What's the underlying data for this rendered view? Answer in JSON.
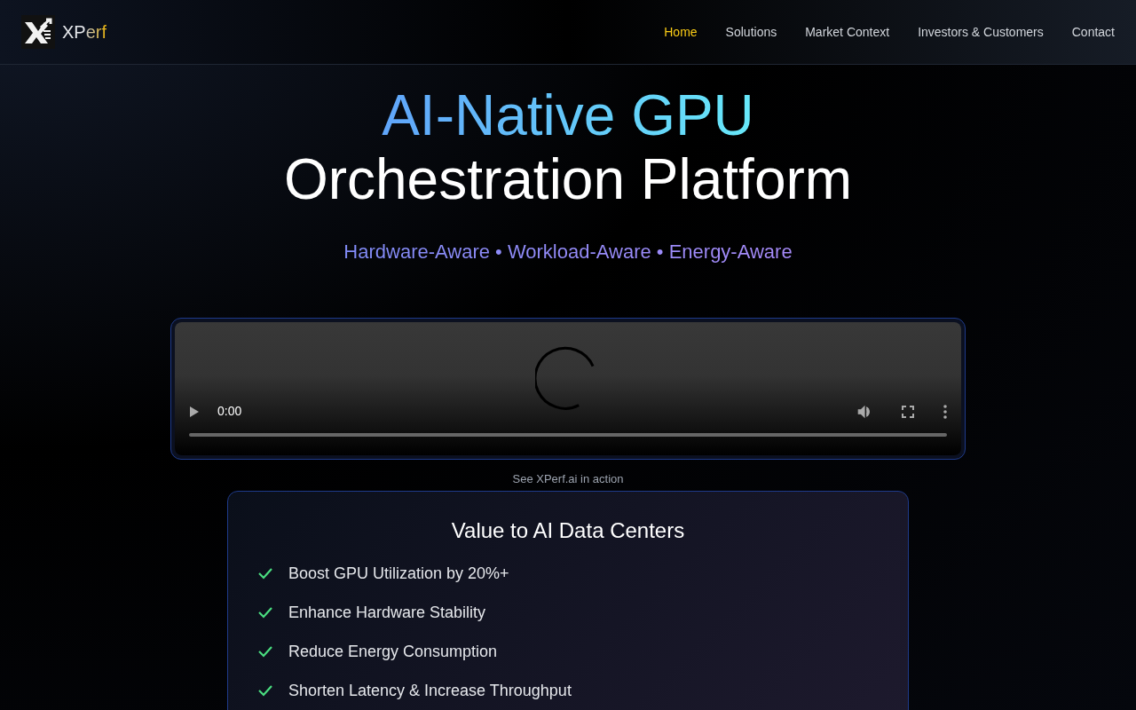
{
  "brand": {
    "name_start": "XP",
    "name_end": "erf"
  },
  "nav": [
    {
      "label": "Home",
      "selected": true
    },
    {
      "label": "Solutions",
      "selected": false
    },
    {
      "label": "Market Context",
      "selected": false
    },
    {
      "label": "Investors & Customers",
      "selected": false
    },
    {
      "label": "Contact",
      "selected": false
    }
  ],
  "hero": {
    "title_line_1": "AI-Native GPU",
    "title_line_2": "Orchestration Platform",
    "tagline": "Hardware-Aware • Workload-Aware • Energy-Aware"
  },
  "video": {
    "time": "0:00",
    "caption": "See XPerf.ai in action"
  },
  "values": {
    "title": "Value to AI Data Centers",
    "items": [
      "Boost GPU Utilization by 20%+",
      "Enhance Hardware Stability",
      "Reduce Energy Consumption",
      "Shorten Latency & Increase Throughput"
    ]
  }
}
